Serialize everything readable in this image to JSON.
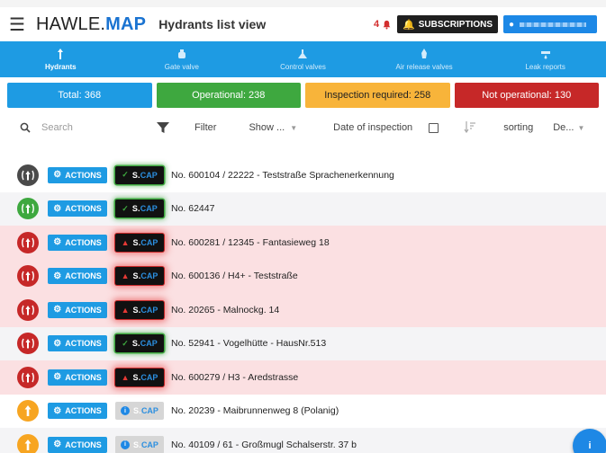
{
  "header": {
    "brand_part1": "HAWLE.",
    "brand_part2": "MAP",
    "title": "Hydrants list view",
    "notification_count": "4",
    "subscriptions_label": "SUBSCRIPTIONS"
  },
  "asset_types": [
    {
      "label": "Hydrants",
      "icon": "hydrant-icon",
      "active": true
    },
    {
      "label": "Gate valve",
      "icon": "gate-valve-icon",
      "active": false
    },
    {
      "label": "Control valves",
      "icon": "control-valve-icon",
      "active": false
    },
    {
      "label": "Air release valves",
      "icon": "air-release-valve-icon",
      "active": false
    },
    {
      "label": "Leak reports",
      "icon": "leak-report-icon",
      "active": false
    }
  ],
  "stats": {
    "total": "Total: 368",
    "operational": "Operational: 238",
    "inspection": "Inspection required: 258",
    "not_operational": "Not operational: 130"
  },
  "filters": {
    "search_placeholder": "Search",
    "filter_label": "Filter",
    "show_value": "Show ...",
    "date_label": "Date of inspection",
    "sorting_label": "sorting",
    "direction_value": "De..."
  },
  "rows": [
    {
      "pin": "grey",
      "bg": "white",
      "scap": "ok",
      "text": "No. 600104 / 22222 - Teststraße Sprachenerkennung"
    },
    {
      "pin": "green",
      "bg": "grey",
      "scap": "ok",
      "text": "No. 62447"
    },
    {
      "pin": "red",
      "bg": "pink",
      "scap": "alarm",
      "text": "No. 600281 / 12345 - Fantasieweg 18"
    },
    {
      "pin": "red",
      "bg": "pink",
      "scap": "alarm",
      "text": "No. 600136 / H4+ - Teststraße"
    },
    {
      "pin": "red",
      "bg": "pink",
      "scap": "alarm",
      "text": "No. 20265 - Malnockg. 14"
    },
    {
      "pin": "red",
      "bg": "grey",
      "scap": "ok",
      "text": "No. 52941 - Vogelhütte - HausNr.513"
    },
    {
      "pin": "red",
      "bg": "pink",
      "scap": "alarm",
      "text": "No. 600279 / H3 - Aredstrasse"
    },
    {
      "pin": "orange",
      "bg": "white",
      "scap": "na",
      "text": "No. 20239 - Maibrunnenweg 8 (Polanig)"
    },
    {
      "pin": "orange",
      "bg": "grey",
      "scap": "na",
      "text": "No. 40109 / 61 - Großmugl Schalserstr. 37 b"
    }
  ],
  "row_labels": {
    "actions": "ACTIONS",
    "scap_s": "S.",
    "scap_cap": "CAP"
  },
  "colors": {
    "primary": "#1e9be3",
    "operational": "#3ea83f",
    "inspection": "#f8b43a",
    "not_operational": "#c62828"
  }
}
